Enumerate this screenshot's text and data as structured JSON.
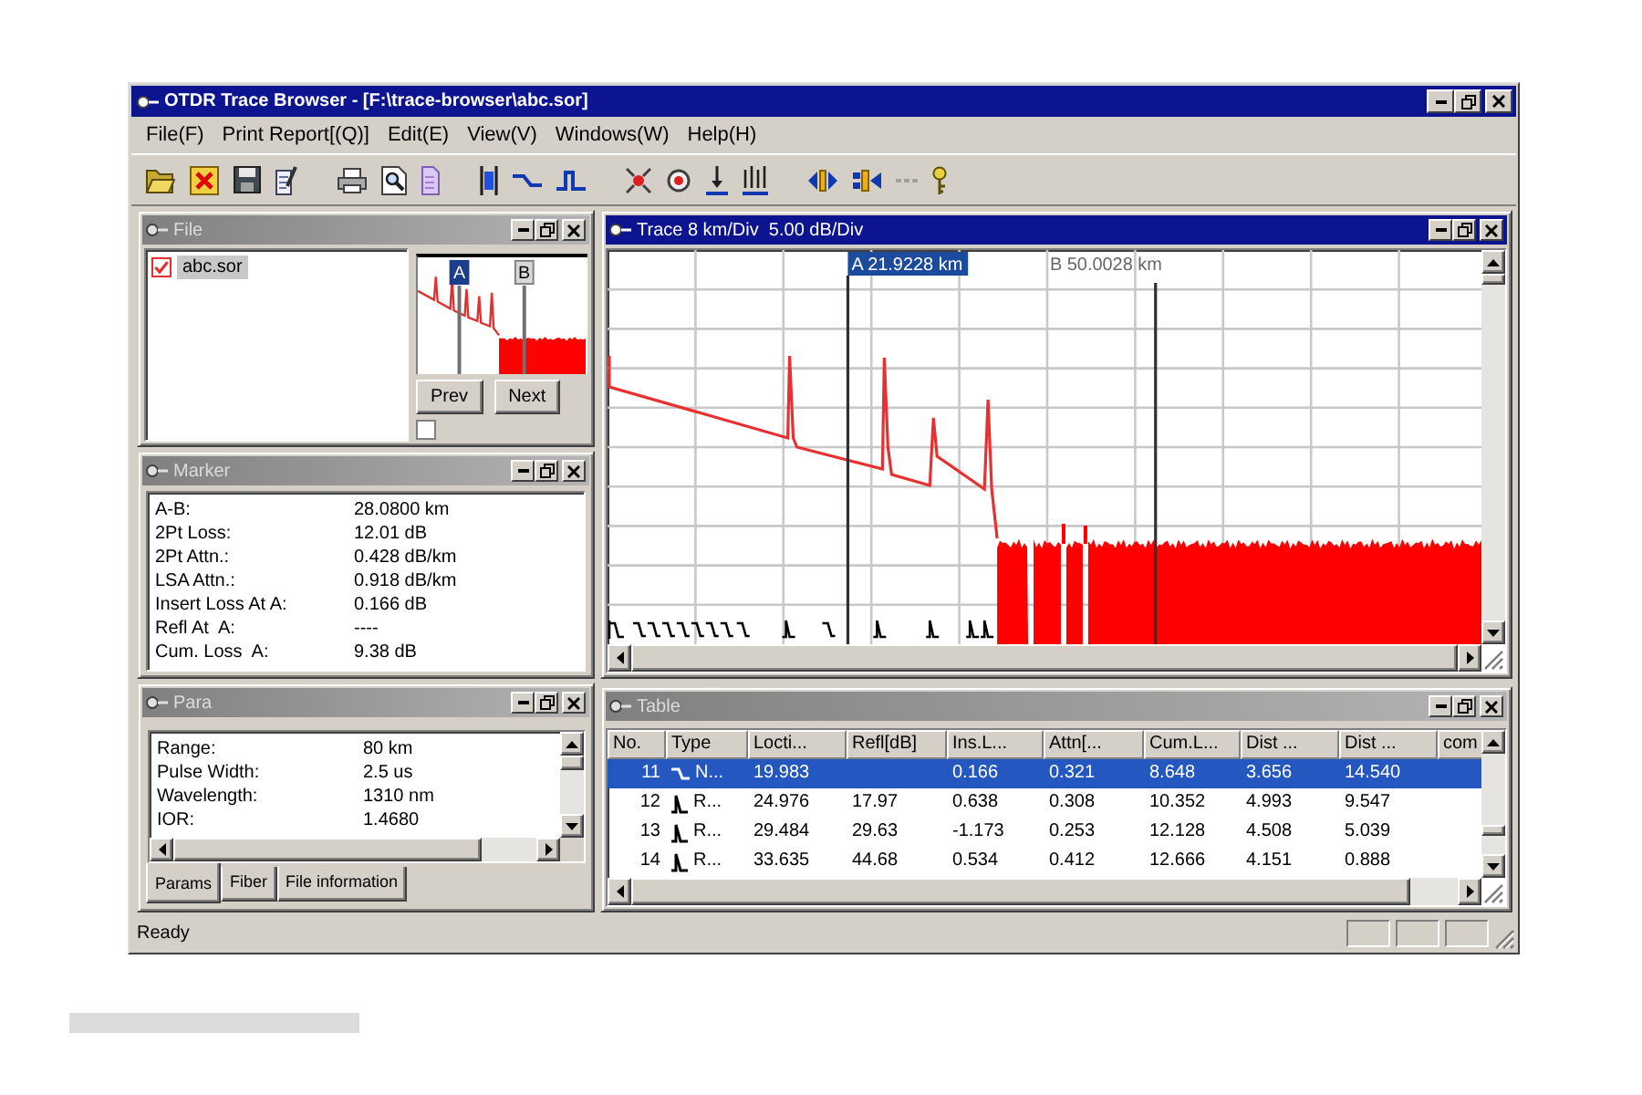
{
  "window": {
    "title": "OTDR Trace Browser - [F:\\trace-browser\\abc.sor]"
  },
  "menu": [
    {
      "label": "File(F)"
    },
    {
      "label": "Print Report[(Q)]"
    },
    {
      "label": "Edit(E)"
    },
    {
      "label": "View(V)"
    },
    {
      "label": "Windows(W)"
    },
    {
      "label": "Help(H)"
    }
  ],
  "file_panel": {
    "title": "File",
    "active": false,
    "files": [
      {
        "name": "abc.sor",
        "checked": true,
        "selected": true
      }
    ],
    "preview": {
      "markers": [
        {
          "label": "A",
          "selected": true
        },
        {
          "label": "B",
          "selected": false
        }
      ]
    },
    "buttons": [
      {
        "label": "Prev"
      },
      {
        "label": "Next"
      }
    ],
    "option": {
      "checked": false
    }
  },
  "marker_panel": {
    "title": "Marker",
    "active": false,
    "rows": [
      {
        "label": "A-B:",
        "value": "28.0800 km"
      },
      {
        "label": "2Pt Loss:",
        "value": "12.01 dB"
      },
      {
        "label": "2Pt Attn.:",
        "value": "0.428 dB/km"
      },
      {
        "label": "LSA Attn.:",
        "value": "0.918 dB/km"
      },
      {
        "label": "Insert Loss At A:",
        "value": "0.166 dB"
      },
      {
        "label": "Refl At  A:",
        "value": "----"
      },
      {
        "label": "Cum. Loss  A:",
        "value": "9.38 dB"
      }
    ]
  },
  "para_panel": {
    "title": "Para",
    "active": false,
    "rows": [
      {
        "label": "Range:",
        "value": "80 km"
      },
      {
        "label": "Pulse Width:",
        "value": "2.5 us"
      },
      {
        "label": "Wavelength:",
        "value": "1310 nm"
      },
      {
        "label": "IOR:",
        "value": "1.4680"
      }
    ],
    "tabs": [
      {
        "label": "Params",
        "selected": true
      },
      {
        "label": "Fiber",
        "selected": false
      },
      {
        "label": "File information",
        "selected": false
      }
    ]
  },
  "trace_panel": {
    "title": "Trace 8 km/Div  5.00 dB/Div",
    "active": true,
    "markers": [
      {
        "label": "A 21.9228 km",
        "selected": true
      },
      {
        "label": "B 50.0028 km",
        "selected": false
      }
    ]
  },
  "table_panel": {
    "title": "Table",
    "active": false,
    "columns": [
      {
        "label": "No."
      },
      {
        "label": "Type"
      },
      {
        "label": "Locti..."
      },
      {
        "label": "Refl[dB]"
      },
      {
        "label": "Ins.L..."
      },
      {
        "label": "Attn[..."
      },
      {
        "label": "Cum.L..."
      },
      {
        "label": "Dist ..."
      },
      {
        "label": "Dist ..."
      },
      {
        "label": "com"
      }
    ],
    "rows": [
      {
        "selected": true,
        "kind": "nonreflective",
        "no": "11",
        "type": "N...",
        "locti": "19.983",
        "ins": "0.166",
        "attn": "0.321",
        "cum": "8.648",
        "dist_1": "3.656",
        "dist_2": "14.540"
      },
      {
        "selected": false,
        "kind": "reflective",
        "no": "12",
        "type": "R...",
        "locti": "24.976",
        "refl": "17.97",
        "ins": "0.638",
        "attn": "0.308",
        "cum": "10.352",
        "dist_1": "4.993",
        "dist_2": "9.547"
      },
      {
        "selected": false,
        "kind": "reflective",
        "no": "13",
        "type": "R...",
        "locti": "29.484",
        "refl": "29.63",
        "ins": "-1.173",
        "attn": "0.253",
        "cum": "12.128",
        "dist_1": "4.508",
        "dist_2": "5.039"
      },
      {
        "selected": false,
        "kind": "reflective",
        "no": "14",
        "type": "R...",
        "locti": "33.635",
        "refl": "44.68",
        "ins": "0.534",
        "attn": "0.412",
        "cum": "12.666",
        "dist_1": "4.151",
        "dist_2": "0.888"
      }
    ]
  },
  "status_bar": {
    "text": "Ready"
  }
}
